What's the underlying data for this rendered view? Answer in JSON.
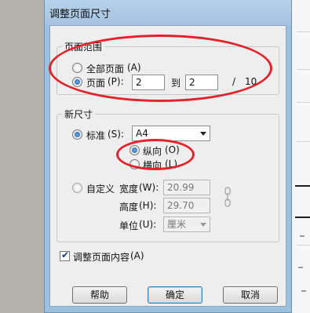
{
  "dialog": {
    "title": "调整页面尺寸"
  },
  "page_range": {
    "legend": "页面范围",
    "all_pages": {
      "label": "全部页面",
      "shortcut": "(A)",
      "selected": false
    },
    "pages": {
      "label": "页面",
      "shortcut": "(P):",
      "selected": true,
      "from": "2",
      "to_label": "到",
      "to": "2",
      "separator": "/",
      "total": "10"
    }
  },
  "new_size": {
    "legend": "新尺寸",
    "standard": {
      "label": "标准",
      "shortcut": "(S):",
      "selected": true,
      "value": "A4"
    },
    "orientation": {
      "portrait": {
        "label": "纵向",
        "shortcut": "(O)",
        "selected": true
      },
      "landscape": {
        "label": "横向",
        "shortcut": "(L)",
        "selected": false
      }
    },
    "custom": {
      "label": "自定义",
      "selected": false,
      "width_label": "宽度",
      "width_shortcut": "(W):",
      "width_value": "20.99",
      "height_label": "高度",
      "height_shortcut": "(H):",
      "height_value": "29.70",
      "unit_label": "单位",
      "unit_shortcut": "(U):",
      "unit_value": "厘米"
    }
  },
  "adjust_content": {
    "label": "调整页面内容",
    "shortcut": "(A)",
    "checked": true
  },
  "buttons": {
    "help": "帮助",
    "ok": "确定",
    "cancel": "取消"
  },
  "annotation_color": "#e3232b"
}
